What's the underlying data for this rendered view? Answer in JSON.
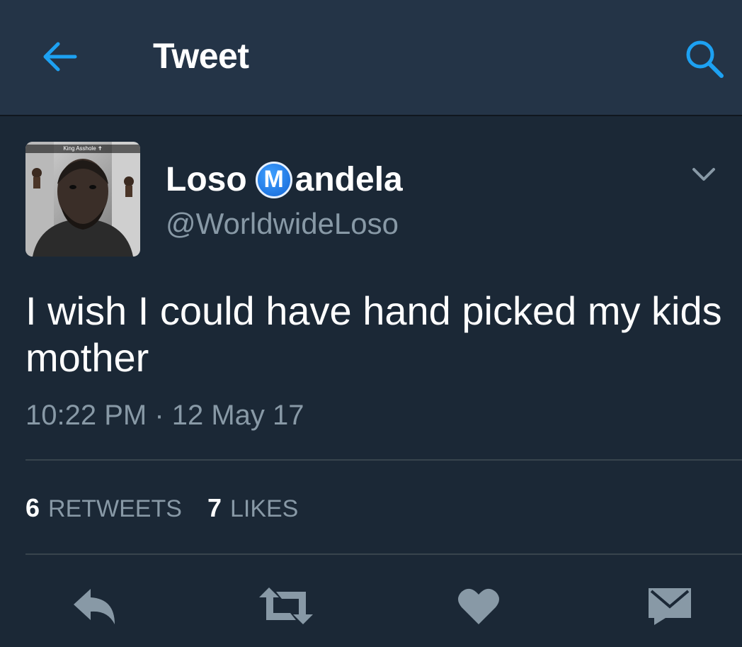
{
  "header": {
    "title": "Tweet",
    "back_icon": "arrow-left-icon",
    "search_icon": "search-icon"
  },
  "tweet": {
    "avatar_caption": "King Asshole ✝",
    "name_first": "Loso",
    "name_logo_letter": "M",
    "name_rest": "andela",
    "handle": "@WorldwideLoso",
    "text": "I wish I could have hand picked my kids mother",
    "timestamp": "10:22 PM · 12 May 17",
    "retweets_count": "6",
    "retweets_label": "RETWEETS",
    "likes_count": "7",
    "likes_label": "LIKES"
  },
  "actions": [
    "reply-icon",
    "retweet-icon",
    "heart-icon",
    "direct-message-icon"
  ],
  "colors": {
    "background": "#1b2836",
    "topbar": "#243447",
    "accent": "#1da1f2",
    "muted": "#8899a6",
    "icon": "#8899a6"
  }
}
